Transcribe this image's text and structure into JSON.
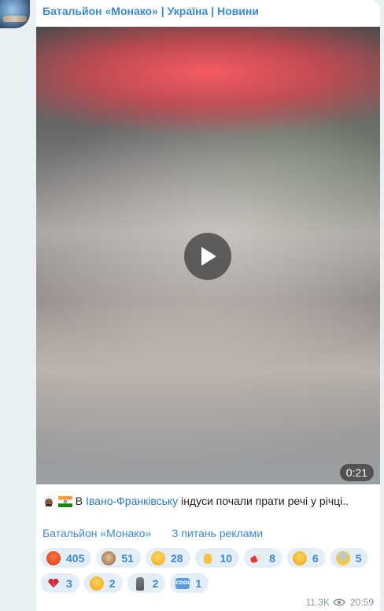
{
  "channel": {
    "title": "Батальйон «Монако» | Україна | Новини"
  },
  "video": {
    "duration": "0:21"
  },
  "caption": {
    "prefix": " В ",
    "link": "Івано-Франківську",
    "rest": " індуси почали прати речі у річці.."
  },
  "footer": {
    "channel_link": "Батальйон «Монако»",
    "ads_link": "З питань реклами"
  },
  "reactions": [
    {
      "icon": "angry-face-icon",
      "count": "405"
    },
    {
      "icon": "see-no-evil-monkey-icon",
      "count": "51"
    },
    {
      "icon": "thinking-face-icon",
      "count": "28"
    },
    {
      "icon": "thumbs-up-icon",
      "count": "10"
    },
    {
      "icon": "pill-icon",
      "count": "8"
    },
    {
      "icon": "woozy-face-icon",
      "count": "6"
    },
    {
      "icon": "screaming-face-icon",
      "count": "5"
    },
    {
      "icon": "broken-heart-icon",
      "count": "3"
    },
    {
      "icon": "smiling-face-with-hearts-icon",
      "count": "2"
    },
    {
      "icon": "moai-icon",
      "count": "2"
    },
    {
      "icon": "cool-button-icon",
      "count": "1"
    }
  ],
  "meta": {
    "views": "11.3K",
    "time": "20:59"
  },
  "colors": {
    "accent": "#3a8ad0",
    "background": "#e9f0f4",
    "reaction_bg": "#e4eef7"
  }
}
